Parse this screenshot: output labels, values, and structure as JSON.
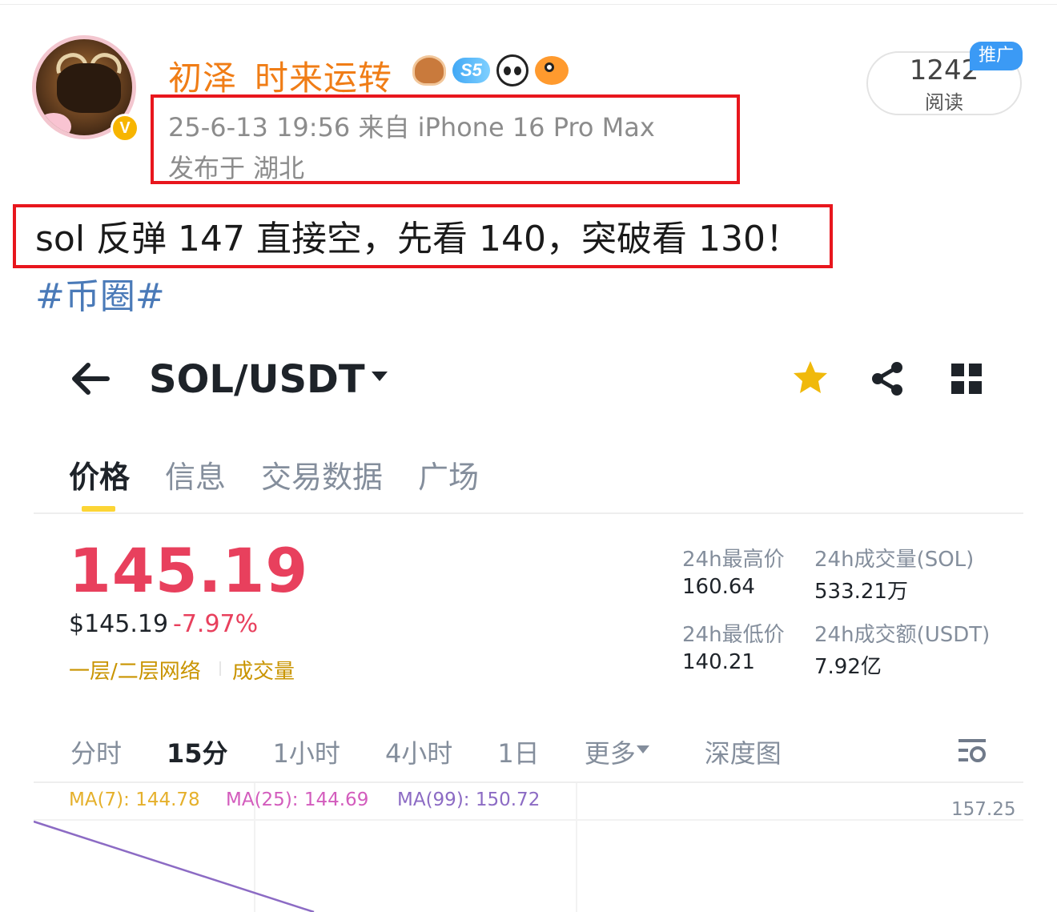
{
  "post": {
    "username": "初泽_时来运转",
    "level_badge": "S5",
    "time_source": "25-6-13 19:56  来自 iPhone 16 Pro Max",
    "location": "发布于 湖北",
    "read_count": "1242",
    "read_label": "阅读",
    "promo_tag": "推广",
    "text": "sol 反弹 147 直接空，先看 140，突破看 130！",
    "hashtag": "#币圈#",
    "highlight_color": "#e8161d",
    "username_color": "#f07d16"
  },
  "app": {
    "pair": "SOL/USDT",
    "tabs": [
      "价格",
      "信息",
      "交易数据",
      "广场"
    ],
    "price": "145.19",
    "usd_price": "$145.19",
    "change": "-7.97%",
    "tag_network": "一层/二层网络",
    "tag_volume": "成交量",
    "stats": {
      "high_label": "24h最高价",
      "high_value": "160.64",
      "vol_sol_label": "24h成交量(SOL)",
      "vol_sol_value": "533.21万",
      "low_label": "24h最低价",
      "low_value": "140.21",
      "vol_usdt_label": "24h成交额(USDT)",
      "vol_usdt_value": "7.92亿"
    },
    "intervals": [
      "分时",
      "15分",
      "1小时",
      "4小时",
      "1日",
      "更多",
      "深度图"
    ],
    "active_interval": "15分",
    "ma7": "MA(7): 144.78",
    "ma25": "MA(25): 144.69",
    "ma99": "MA(99): 150.72",
    "axis_top": "157.25",
    "down_color": "#e8405d",
    "accent_color": "#fcd535"
  }
}
